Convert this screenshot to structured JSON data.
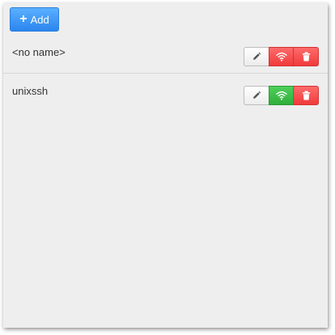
{
  "toolbar": {
    "add_label": "Add",
    "add_icon": "plus-icon"
  },
  "connections": [
    {
      "name": "<no name>",
      "status": "disconnected",
      "status_color": "#f04a4a",
      "actions": [
        "pencil-icon",
        "wifi-icon",
        "trash-icon"
      ]
    },
    {
      "name": "unixssh",
      "status": "connected",
      "status_color": "#36b443",
      "actions": [
        "pencil-icon",
        "wifi-icon",
        "trash-icon"
      ]
    }
  ],
  "colors": {
    "accent": "#2b86ee",
    "danger": "#f04a4a",
    "success": "#36b443",
    "panel_bg": "#eeeeee"
  }
}
